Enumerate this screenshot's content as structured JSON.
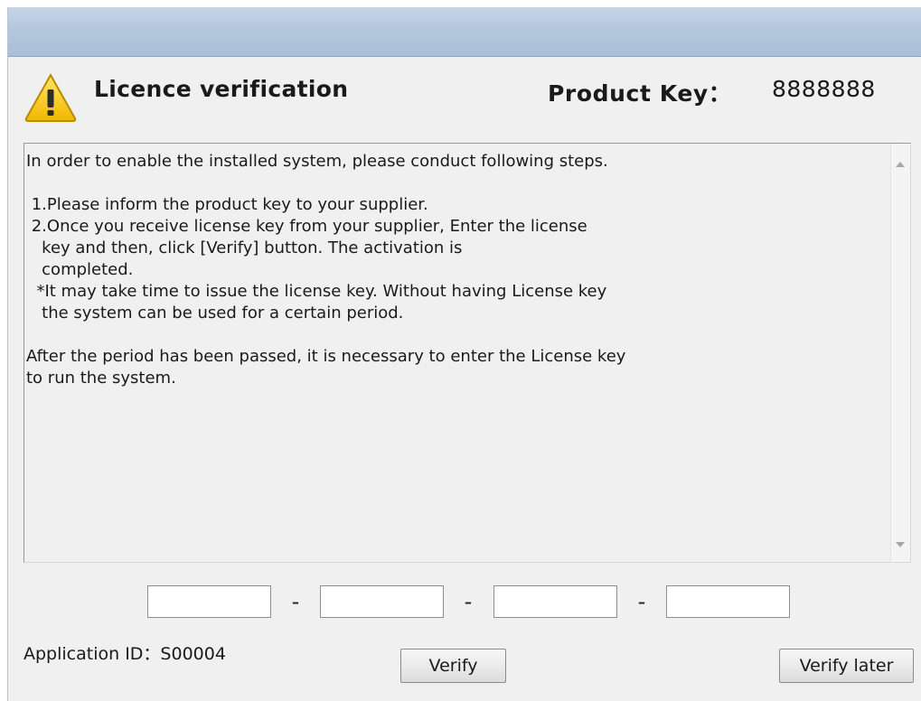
{
  "dialog": {
    "title": "Licence verification",
    "product_key_label": "Product Key：",
    "product_key_value": "8888888"
  },
  "message": {
    "text": "In order to enable the installed system, please conduct following steps.\n\n 1.Please inform the product key to your supplier.\n 2.Once you receive license key from your supplier, Enter the license\n   key and then, click [Verify] button. The activation is\n   completed.\n  *It may take time to issue the license key. Without having License key\n   the system can be used for a certain period.\n\nAfter the period has been passed, it is necessary to enter the License key\nto run the system."
  },
  "license_key": {
    "fields": [
      "",
      "",
      "",
      ""
    ],
    "separator": "-"
  },
  "application_id": "Application ID：S00004",
  "buttons": {
    "verify": "Verify",
    "verify_later": "Verify later"
  },
  "icons": {
    "warning": "warning-triangle-icon"
  },
  "colors": {
    "titlebar": "#b4c8dd",
    "window_bg": "#f0f0f0",
    "warning_yellow": "#f5c400"
  }
}
